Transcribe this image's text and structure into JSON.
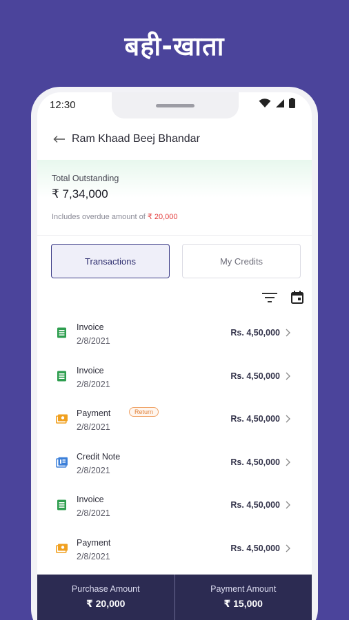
{
  "banner": {
    "title": "बही-खाता"
  },
  "status_bar": {
    "time": "12:30",
    "icons": [
      "wifi-icon",
      "cellular-signal-icon",
      "battery-icon"
    ]
  },
  "appbar": {
    "title": "Ram Khaad Beej Bhandar",
    "back_icon": "arrow-left-icon"
  },
  "outstanding": {
    "label": "Total Outstanding",
    "amount": "₹ 7,34,000",
    "overdue_prefix": "Includes overdue amount of",
    "overdue_amount": "₹ 20,000"
  },
  "tabs": [
    {
      "label": "Transactions",
      "active": true
    },
    {
      "label": "My Credits",
      "active": false
    }
  ],
  "tools": [
    "filter-icon",
    "calendar-icon"
  ],
  "transactions": [
    {
      "type": "Invoice",
      "date": "2/8/2021",
      "amount": "Rs. 4,50,000",
      "icon": "invoice-icon",
      "badge": ""
    },
    {
      "type": "Invoice",
      "date": "2/8/2021",
      "amount": "Rs. 4,50,000",
      "icon": "invoice-icon",
      "badge": ""
    },
    {
      "type": "Payment",
      "date": "2/8/2021",
      "amount": "Rs. 4,50,000",
      "icon": "payment-icon",
      "badge": "Return"
    },
    {
      "type": "Credit Note",
      "date": "2/8/2021",
      "amount": "Rs. 4,50,000",
      "icon": "credit-note-icon",
      "badge": ""
    },
    {
      "type": "Invoice",
      "date": "2/8/2021",
      "amount": "Rs. 4,50,000",
      "icon": "invoice-icon",
      "badge": ""
    },
    {
      "type": "Payment",
      "date": "2/8/2021",
      "amount": "Rs. 4,50,000",
      "icon": "payment-icon",
      "badge": ""
    }
  ],
  "summary": {
    "purchase_label": "Purchase Amount",
    "purchase_value": "₹ 20,000",
    "payment_label": "Payment Amount",
    "payment_value": "₹ 15,000"
  },
  "colors": {
    "background": "#4b449b",
    "invoice_green": "#2e9e4f",
    "payment_orange": "#f0a020",
    "credit_blue": "#3b7fd9",
    "overdue_red": "#e33b3b",
    "bottom_bar": "#2c2b52"
  }
}
